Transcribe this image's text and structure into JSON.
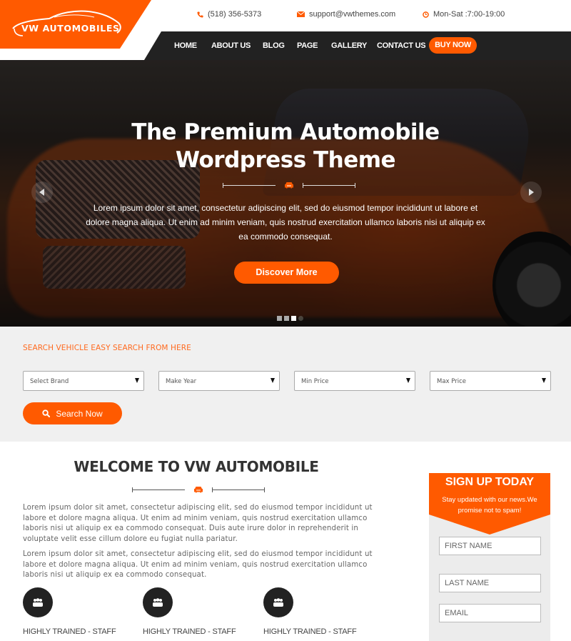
{
  "brand": {
    "logo_text": "VW AUTOMOBILES",
    "accent_color": "#ff5a00",
    "dark_color": "#222222"
  },
  "topbar": {
    "phone": {
      "icon": "phone-icon",
      "text": "(518) 356-5373"
    },
    "email": {
      "icon": "envelope-icon",
      "text": "support@vwthemes.com"
    },
    "hours": {
      "icon": "clock-icon",
      "text": "Mon-Sat :7:00-19:00"
    }
  },
  "nav": {
    "items": [
      {
        "label": "HOME"
      },
      {
        "label": "ABOUT US"
      },
      {
        "label": "BLOG"
      },
      {
        "label": "PAGE"
      },
      {
        "label": "GALLERY"
      },
      {
        "label": "CONTACT US"
      }
    ],
    "cta": "BUY NOW"
  },
  "hero": {
    "title_line1": "The Premium Automobile",
    "title_line2": "Wordpress Theme",
    "text": "Lorem ipsum dolor sit amet, consectetur adipiscing elit, sed do eiusmod tempor incididunt ut labore et dolore magna aliqua. Ut enim ad minim veniam, quis nostrud exercitation ullamco laboris nisi ut aliquip ex ea commodo consequat.",
    "button": "Discover More",
    "slides_total": 4,
    "active_slide": 3
  },
  "search": {
    "title": "SEARCH VEHICLE EASY SEARCH FROM HERE",
    "selects": [
      {
        "value": "Select Brand"
      },
      {
        "value": "Make Year"
      },
      {
        "value": "Min Price"
      },
      {
        "value": "Max Price"
      }
    ],
    "button": "Search Now"
  },
  "welcome": {
    "title": "WELCOME TO VW AUTOMOBILE",
    "para1": "Lorem ipsum dolor sit amet, consectetur adipiscing elit, sed do eiusmod tempor incididunt ut labore et dolore magna aliqua. Ut enim ad minim veniam, quis nostrud exercitation ullamco laboris nisi ut aliquip ex ea commodo consequat. Duis aute irure dolor in reprehenderit in voluptate velit esse cillum dolore eu fugiat nulla pariatur.",
    "para2": "Lorem ipsum dolor sit amet, consectetur adipiscing elit, sed do eiusmod tempor incididunt ut labore et dolore magna aliqua. Ut enim ad minim veniam, quis nostrud exercitation ullamco laboris nisi ut aliquip ex ea commodo consequat.",
    "features": [
      {
        "icon": "users-icon",
        "label": "HIGHLY TRAINED - STAFF"
      },
      {
        "icon": "users-icon",
        "label": "HIGHLY TRAINED - STAFF"
      },
      {
        "icon": "users-icon",
        "label": "HIGHLY TRAINED - STAFF"
      }
    ]
  },
  "signup": {
    "title": "SIGN UP TODAY",
    "subtitle": "Stay updated with our news.We promise not to spam!",
    "fields": [
      {
        "placeholder": "FIRST NAME"
      },
      {
        "placeholder": "LAST NAME"
      },
      {
        "placeholder": "EMAIL"
      }
    ]
  }
}
